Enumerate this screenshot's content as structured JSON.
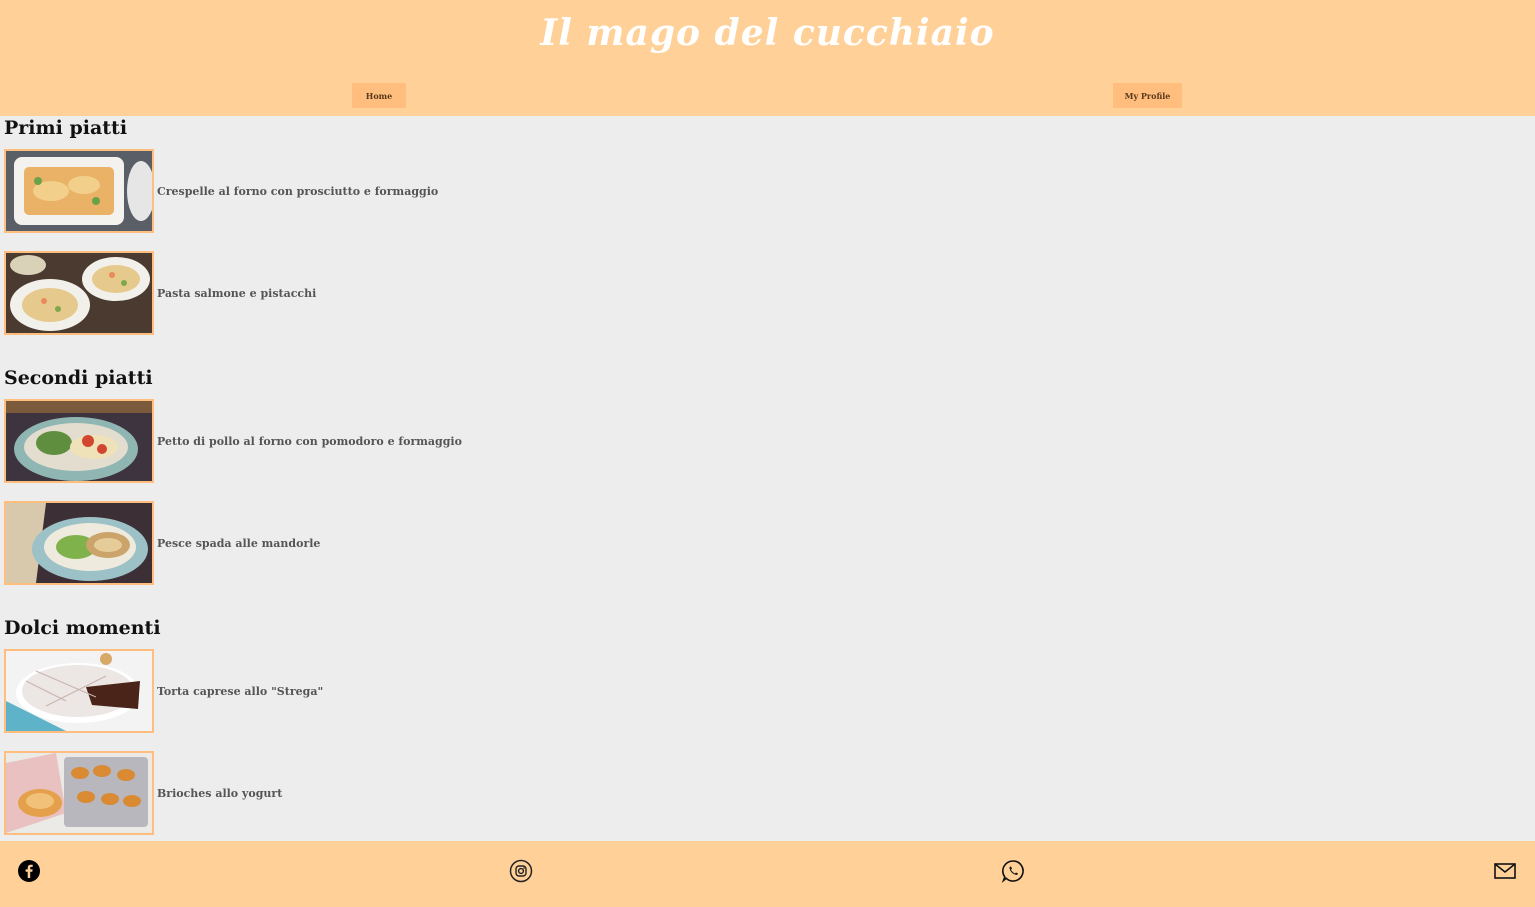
{
  "header": {
    "title": "Il mago del cucchiaio",
    "nav": {
      "home_label": "Home",
      "profile_label": "My Profile"
    }
  },
  "sections": [
    {
      "title": "Primi piatti",
      "recipes": [
        {
          "label": "Crespelle al forno con prosciutto e formaggio"
        },
        {
          "label": "Pasta salmone e pistacchi"
        }
      ]
    },
    {
      "title": "Secondi piatti",
      "recipes": [
        {
          "label": "Petto di pollo al forno con pomodoro e formaggio"
        },
        {
          "label": "Pesce spada alle mandorle"
        }
      ]
    },
    {
      "title": "Dolci momenti",
      "recipes": [
        {
          "label": "Torta caprese allo \"Strega\""
        },
        {
          "label": "Brioches allo yogurt"
        }
      ]
    }
  ],
  "footer": {
    "icons": [
      "facebook-icon",
      "instagram-icon",
      "whatsapp-icon",
      "mail-icon"
    ]
  },
  "colors": {
    "header_bg": "#ffd199",
    "accent": "#ffbe7d",
    "page_bg": "#ededed"
  }
}
